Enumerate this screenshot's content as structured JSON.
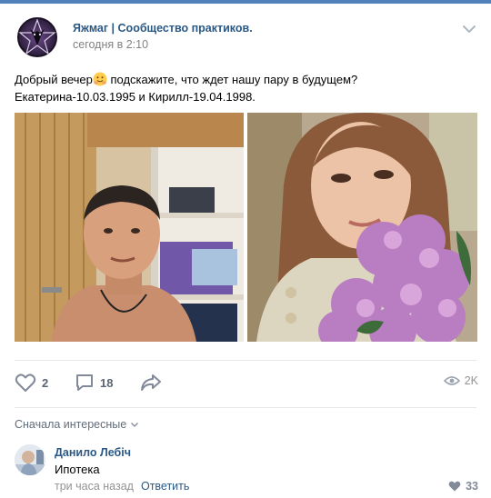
{
  "post": {
    "author": "Яжмаг | Сообщество практиков.",
    "date": "сегодня в 2:10",
    "text_line1_before_emoji": "Добрый вечер",
    "text_line1_after_emoji": " подскажите, что ждет нашу пару в будущем?",
    "text_line2": "Екатерина-10.03.1995 и Кирилл-19.04.1998."
  },
  "actions": {
    "likes": "2",
    "comments": "18",
    "views": "2K"
  },
  "comments": {
    "sort_label": "Сначала интересные",
    "items": [
      {
        "author": "Данило Лебіч",
        "text": "Ипотека",
        "time": "три часа назад",
        "reply_label": "Ответить",
        "likes": "33"
      }
    ]
  },
  "colors": {
    "link": "#2a5885",
    "accent": "#5181b8",
    "meta": "#828282",
    "icon": "#828a99"
  },
  "icons": [
    "pentagram-goat-avatar",
    "chevron-down-icon",
    "heart-icon",
    "comment-icon",
    "share-icon",
    "eye-icon"
  ]
}
